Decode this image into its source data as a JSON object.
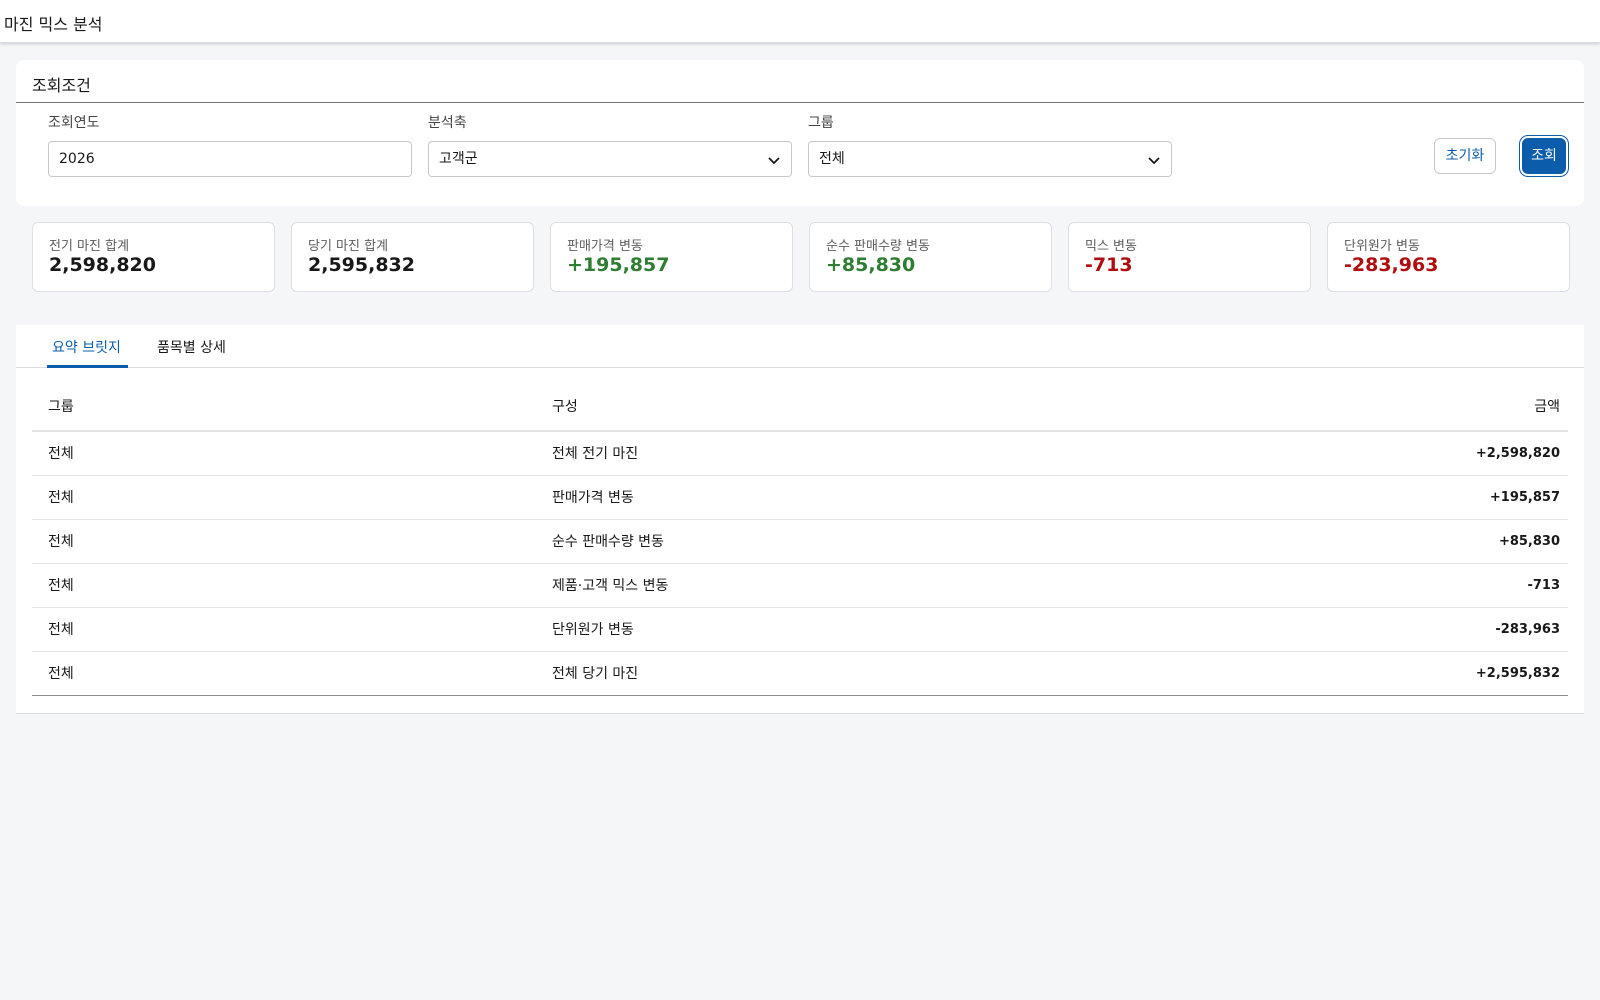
{
  "app": {
    "title": "마진 믹스 분석"
  },
  "search": {
    "card_title": "조회조건",
    "year_label": "조회연도",
    "year_value": "2026",
    "axis_label": "분석축",
    "axis_value": "고객군",
    "group_label": "그룹",
    "group_value": "전체",
    "reset_label": "초기화",
    "search_label": "조회"
  },
  "kpis": [
    {
      "label": "전기 마진 합계",
      "value": "2,598,820",
      "tone": "neutral"
    },
    {
      "label": "당기 마진 합계",
      "value": "2,595,832",
      "tone": "neutral"
    },
    {
      "label": "판매가격 변동",
      "value": "+195,857",
      "tone": "pos"
    },
    {
      "label": "순수 판매수량 변동",
      "value": "+85,830",
      "tone": "pos"
    },
    {
      "label": "믹스 변동",
      "value": "-713",
      "tone": "neg"
    },
    {
      "label": "단위원가 변동",
      "value": "-283,963",
      "tone": "neg"
    }
  ],
  "tabs": [
    {
      "label": "요약 브릿지",
      "active": true
    },
    {
      "label": "품목별 상세",
      "active": false
    }
  ],
  "table": {
    "headers": [
      "그룹",
      "구성",
      "금액"
    ],
    "rows": [
      {
        "group": "전체",
        "item": "전체 전기 마진",
        "amount": "+2,598,820",
        "tone": "pos"
      },
      {
        "group": "전체",
        "item": "판매가격 변동",
        "amount": "+195,857",
        "tone": "pos"
      },
      {
        "group": "전체",
        "item": "순수 판매수량 변동",
        "amount": "+85,830",
        "tone": "pos"
      },
      {
        "group": "전체",
        "item": "제품·고객 믹스 변동",
        "amount": "-713",
        "tone": "neg"
      },
      {
        "group": "전체",
        "item": "단위원가 변동",
        "amount": "-283,963",
        "tone": "neg"
      },
      {
        "group": "전체",
        "item": "전체 당기 마진",
        "amount": "+2,595,832",
        "tone": "pos"
      }
    ]
  },
  "colors": {
    "brand": "#0b5cab",
    "positive": "#2e7d32",
    "negative": "#b00e0e"
  }
}
